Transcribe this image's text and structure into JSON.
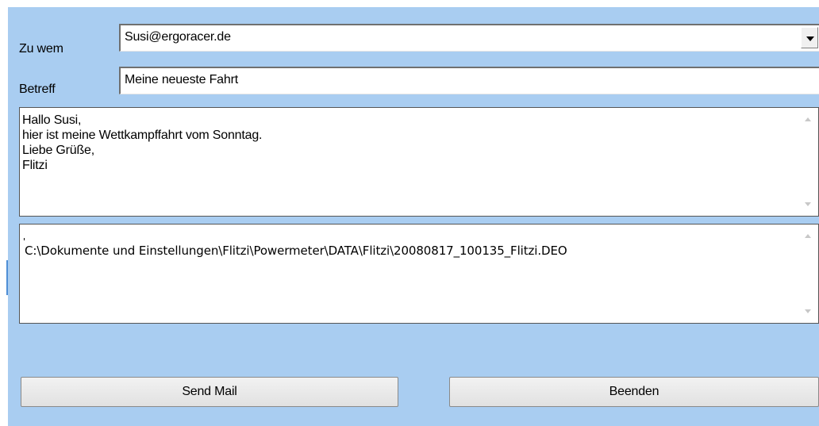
{
  "form": {
    "to_label": "Zu wem",
    "to_value": "Susi@ergoracer.de",
    "subject_label": "Betreff",
    "subject_value": "Meine neueste Fahrt"
  },
  "message": {
    "lines": [
      "Hallo Susi,",
      "hier ist meine Wettkampffahrt vom Sonntag.",
      "Liebe Grüße,",
      "Flitzi"
    ]
  },
  "attachment": {
    "path": "C:\\Dokumente und Einstellungen\\Flitzi\\Powermeter\\DATA\\Flitzi\\20080817_100135_Flitzi.DEO"
  },
  "buttons": {
    "send_label": "Send Mail",
    "quit_label": "Beenden"
  },
  "icons": {
    "dropdown": "chevron-down-icon",
    "scroll_up": "scroll-up-icon",
    "scroll_down": "scroll-down-icon"
  },
  "colors": {
    "panel_background": "#a9cdf1"
  }
}
